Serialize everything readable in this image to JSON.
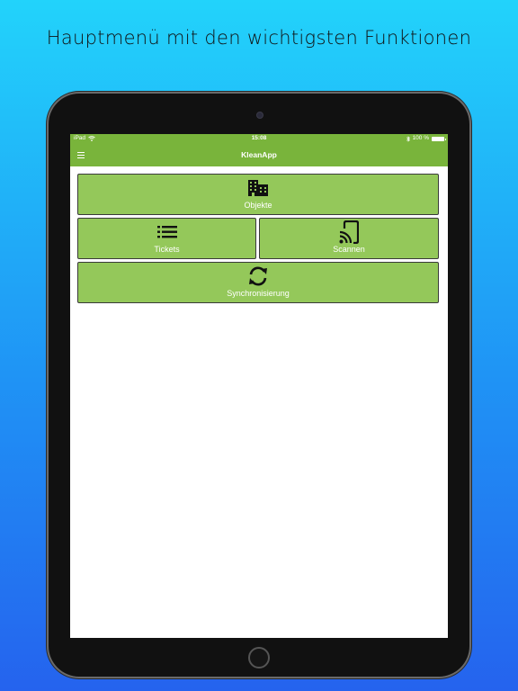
{
  "headline": "Hauptmenü mit den wichtigsten Funktionen",
  "status_bar": {
    "device": "iPad",
    "time": "15:08",
    "battery_text": "100 %",
    "battery_level": 1.0
  },
  "navbar": {
    "title": "KleanApp",
    "menu_icon": "hamburger-icon"
  },
  "tiles": [
    {
      "id": "objekte",
      "label": "Objekte",
      "icon": "building-icon"
    },
    {
      "id": "tickets",
      "label": "Tickets",
      "icon": "list-icon"
    },
    {
      "id": "scannen",
      "label": "Scannen",
      "icon": "cast-phone-icon"
    },
    {
      "id": "synchronisierung",
      "label": "Synchronisierung",
      "icon": "sync-icon"
    }
  ],
  "colors": {
    "accent": "#79b43b",
    "tile": "#94c85a",
    "background_top": "#22d3fb",
    "background_bottom": "#2563ee"
  }
}
